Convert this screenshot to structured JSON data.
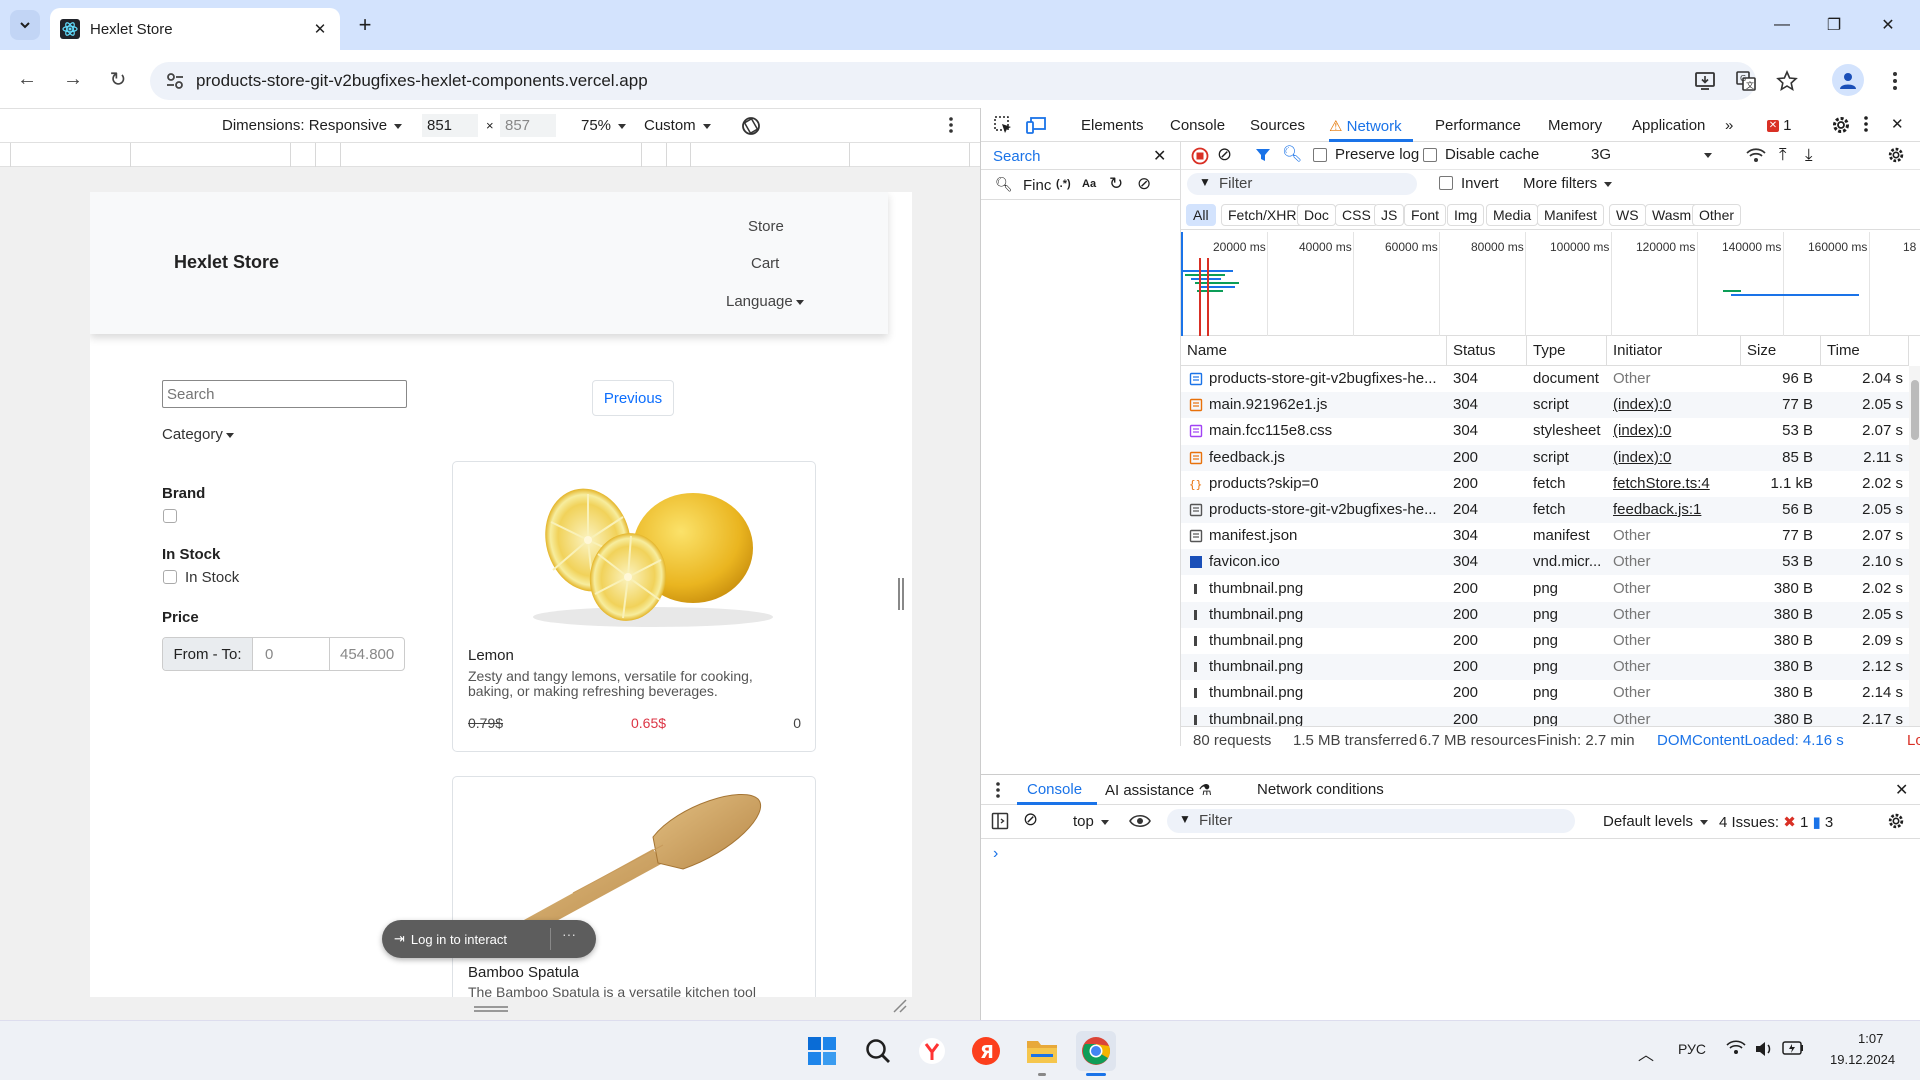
{
  "browser": {
    "tab_title": "Hexlet Store",
    "url": "products-store-git-v2bugfixes-hexlet-components.vercel.app"
  },
  "device_toolbar": {
    "dimensions_label": "Dimensions: Responsive",
    "width": "851",
    "height": "857",
    "zoom": "75%",
    "throttle": "Custom"
  },
  "site": {
    "brand": "Hexlet Store",
    "nav": {
      "store": "Store",
      "cart": "Cart",
      "language": "Language"
    },
    "search_placeholder": "Search",
    "previous": "Previous",
    "category": "Category",
    "brand_label": "Brand",
    "instock_label": "In Stock",
    "instock_option": "In Stock",
    "price_label": "Price",
    "price_from_to": "From - To:",
    "price_min": "0",
    "price_max": "454.800",
    "products": [
      {
        "name": "Lemon",
        "description": "Zesty and tangy lemons, versatile for cooking, baking, or making refreshing beverages.",
        "old_price": "0.79$",
        "new_price": "0.65$",
        "qty": "0"
      },
      {
        "name": "Bamboo Spatula",
        "description": "The Bamboo Spatula is a versatile kitchen tool"
      }
    ],
    "login_overlay": "Log in to interact",
    "login_more": "···"
  },
  "devtools": {
    "tabs": [
      "Elements",
      "Console",
      "Sources",
      "Network",
      "Performance",
      "Memory",
      "Application"
    ],
    "active_tab": "Network",
    "error_count": "1",
    "search_title": "Search",
    "search_value": "Finc",
    "regex_label": "(.*)",
    "case_label": "Aa",
    "preserve_log": "Preserve log",
    "disable_cache": "Disable cache",
    "throttling": "3G",
    "filter_placeholder": "Filter",
    "invert": "Invert",
    "more_filters": "More filters",
    "type_filters": [
      "All",
      "Fetch/XHR",
      "Doc",
      "CSS",
      "JS",
      "Font",
      "Img",
      "Media",
      "Manifest",
      "WS",
      "Wasm",
      "Other"
    ],
    "timeline_ticks": [
      "20000 ms",
      "40000 ms",
      "60000 ms",
      "80000 ms",
      "100000 ms",
      "120000 ms",
      "140000 ms",
      "160000 ms",
      "18"
    ],
    "columns": [
      "Name",
      "Status",
      "Type",
      "Initiator",
      "Size",
      "Time"
    ],
    "rows": [
      {
        "name": "products-store-git-v2bugfixes-he...",
        "status": "304",
        "type": "document",
        "initiator": "Other",
        "size": "96 B",
        "time": "2.04 s",
        "icon": "doc"
      },
      {
        "name": "main.921962e1.js",
        "status": "304",
        "type": "script",
        "initiator": "(index):0",
        "size": "77 B",
        "time": "2.05 s",
        "icon": "script"
      },
      {
        "name": "main.fcc115e8.css",
        "status": "304",
        "type": "stylesheet",
        "initiator": "(index):0",
        "size": "53 B",
        "time": "2.07 s",
        "icon": "css"
      },
      {
        "name": "feedback.js",
        "status": "200",
        "type": "script",
        "initiator": "(index):0",
        "size": "85 B",
        "time": "2.11 s",
        "icon": "script"
      },
      {
        "name": "products?skip=0",
        "status": "200",
        "type": "fetch",
        "initiator": "fetchStore.ts:4",
        "size": "1.1 kB",
        "time": "2.02 s",
        "icon": "fetch"
      },
      {
        "name": "products-store-git-v2bugfixes-he...",
        "status": "204",
        "type": "fetch",
        "initiator": "feedback.js:1",
        "size": "56 B",
        "time": "2.05 s",
        "icon": "file"
      },
      {
        "name": "manifest.json",
        "status": "304",
        "type": "manifest",
        "initiator": "Other",
        "size": "77 B",
        "time": "2.07 s",
        "icon": "manifest"
      },
      {
        "name": "favicon.ico",
        "status": "304",
        "type": "vnd.micr...",
        "initiator": "Other",
        "size": "53 B",
        "time": "2.10 s",
        "icon": "ico"
      },
      {
        "name": "thumbnail.png",
        "status": "200",
        "type": "png",
        "initiator": "Other",
        "size": "380 B",
        "time": "2.02 s",
        "icon": "img"
      },
      {
        "name": "thumbnail.png",
        "status": "200",
        "type": "png",
        "initiator": "Other",
        "size": "380 B",
        "time": "2.05 s",
        "icon": "img"
      },
      {
        "name": "thumbnail.png",
        "status": "200",
        "type": "png",
        "initiator": "Other",
        "size": "380 B",
        "time": "2.09 s",
        "icon": "img"
      },
      {
        "name": "thumbnail.png",
        "status": "200",
        "type": "png",
        "initiator": "Other",
        "size": "380 B",
        "time": "2.12 s",
        "icon": "img"
      },
      {
        "name": "thumbnail.png",
        "status": "200",
        "type": "png",
        "initiator": "Other",
        "size": "380 B",
        "time": "2.14 s",
        "icon": "img"
      },
      {
        "name": "thumbnail.png",
        "status": "200",
        "type": "png",
        "initiator": "Other",
        "size": "380 B",
        "time": "2.17 s",
        "icon": "img"
      }
    ],
    "status_bar": {
      "requests": "80 requests",
      "transferred": "1.5 MB transferred",
      "resources": "6.7 MB resources",
      "finish": "Finish: 2.7 min",
      "dcl": "DOMContentLoaded: 4.16 s",
      "load": "Lo"
    },
    "drawer": {
      "tabs": [
        "Console",
        "AI assistance",
        "Network conditions"
      ],
      "context": "top",
      "filter_placeholder": "Filter",
      "levels": "Default levels",
      "issues": "4 Issues:",
      "issues_errors": "1",
      "issues_info": "3",
      "prompt": "›"
    }
  },
  "taskbar": {
    "lang": "РУС",
    "time": "1:07",
    "date": "19.12.2024"
  },
  "colors": {
    "accent": "#1a73e8",
    "error": "#dc3545",
    "link": "#0d6efd",
    "titlebar": "#d3e3fd"
  }
}
